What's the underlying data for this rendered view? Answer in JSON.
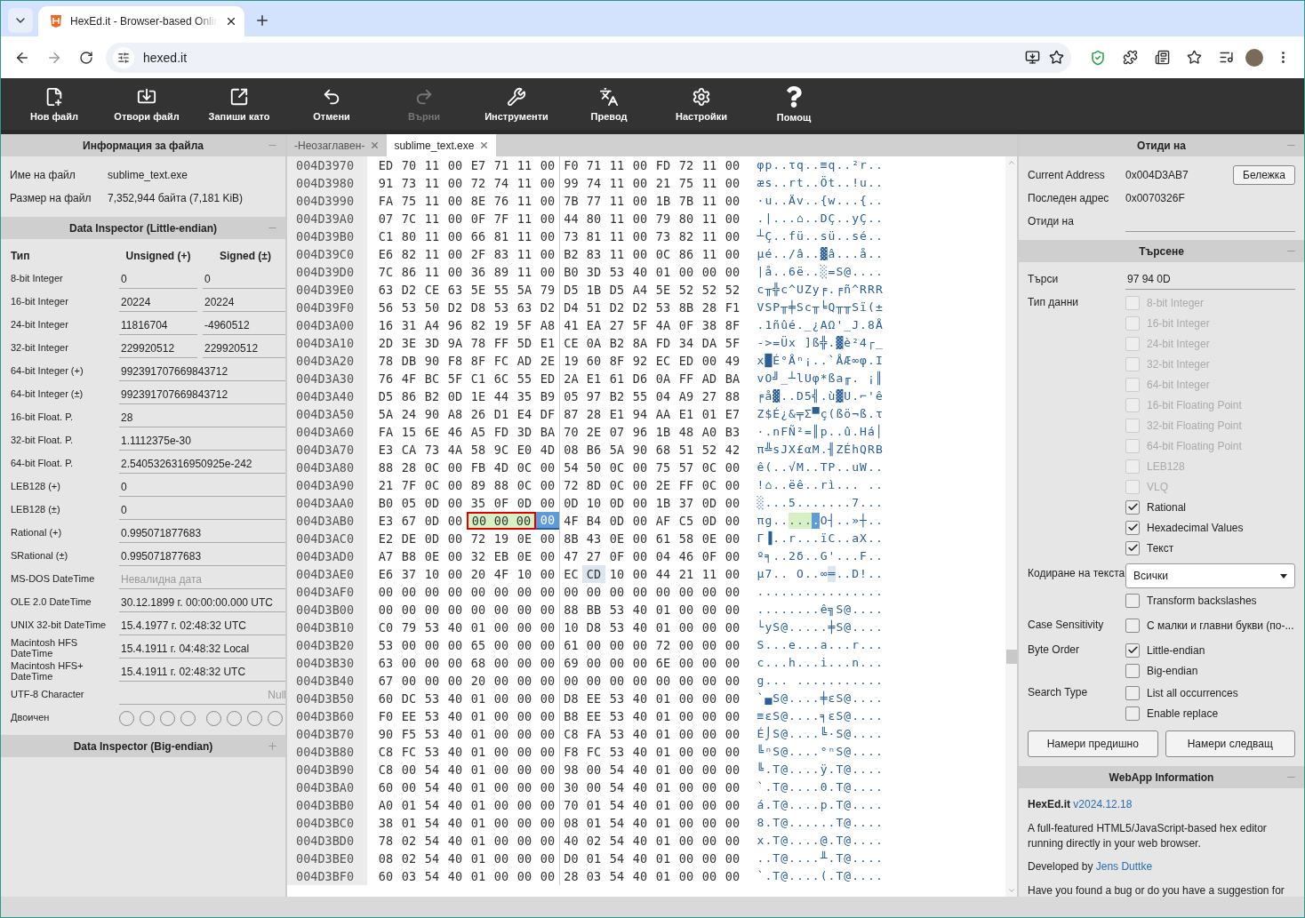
{
  "browser": {
    "tab_title": "HexEd.it - Browser-based Onlin",
    "url": "hexed.it"
  },
  "toolbar": [
    {
      "label": "Нов файл",
      "disabled": false
    },
    {
      "label": "Отвори файл",
      "disabled": false
    },
    {
      "label": "Запиши като",
      "disabled": false
    },
    {
      "label": "Отмени",
      "disabled": false
    },
    {
      "label": "Върни",
      "disabled": true
    },
    {
      "label": "Инструменти",
      "disabled": false
    },
    {
      "label": "Превод",
      "disabled": false
    },
    {
      "label": "Настройки",
      "disabled": false
    },
    {
      "label": "Помощ",
      "disabled": false
    }
  ],
  "file_info": {
    "title": "Информация за файла",
    "expanded": true,
    "fields": [
      {
        "label": "Име на файл",
        "value": "sublime_text.exe"
      },
      {
        "label": "Размер на файл",
        "value": "7,352,944 байта (7,181 KiB)"
      }
    ]
  },
  "inspector": {
    "title": "Data Inspector (Little-endian)",
    "expanded": true,
    "columns": [
      "Тип",
      "Unsigned (+)",
      "Signed (±)"
    ],
    "rows": [
      {
        "kind": "pair",
        "label": "8-bit Integer",
        "unsigned": "0",
        "signed": "0"
      },
      {
        "kind": "pair",
        "label": "16-bit Integer",
        "unsigned": "20224",
        "signed": "20224"
      },
      {
        "kind": "pair",
        "label": "24-bit Integer",
        "unsigned": "11816704",
        "signed": "-4960512"
      },
      {
        "kind": "pair",
        "label": "32-bit Integer",
        "unsigned": "229920512",
        "signed": "229920512"
      },
      {
        "kind": "single",
        "label": "64-bit Integer (+)",
        "value": "992391707669843712"
      },
      {
        "kind": "single",
        "label": "64-bit Integer (±)",
        "value": "992391707669843712"
      },
      {
        "kind": "single",
        "label": "16-bit Float. P.",
        "value": "28"
      },
      {
        "kind": "single",
        "label": "32-bit Float. P.",
        "value": "1.1112375e-30"
      },
      {
        "kind": "single",
        "label": "64-bit Float. P.",
        "value": "2.5405326316950925e-242"
      },
      {
        "kind": "single",
        "label": "LEB128 (+)",
        "value": "0"
      },
      {
        "kind": "single",
        "label": "LEB128 (±)",
        "value": "0"
      },
      {
        "kind": "single",
        "label": "Rational (+)",
        "value": "0.995071877683"
      },
      {
        "kind": "single",
        "label": "SRational (±)",
        "value": "0.995071877683"
      },
      {
        "kind": "single",
        "label": "MS-DOS DateTime",
        "placeholder": "Невалидна дата"
      },
      {
        "kind": "single",
        "label": "OLE 2.0 DateTime",
        "value": "30.12.1899 г. 00:00:00.000 UTC"
      },
      {
        "kind": "single",
        "label": "UNIX 32-bit DateTime",
        "value": "15.4.1977 г. 02:48:32 UTC"
      },
      {
        "kind": "single",
        "label": "Macintosh HFS DateTime",
        "value": "15.4.1911 г. 04:48:32 Local"
      },
      {
        "kind": "single",
        "label": "Macintosh HFS+ DateTime",
        "value": "15.4.1911 г. 02:48:32 UTC"
      },
      {
        "kind": "char",
        "label": "UTF-8 Character",
        "placeholder": "Null"
      },
      {
        "kind": "bits",
        "label": "Двоичен",
        "bits": [
          {
            "checked": false
          },
          {
            "checked": false
          },
          {
            "checked": false
          },
          {
            "checked": false
          },
          {
            "checked": false
          },
          {
            "checked": false
          },
          {
            "checked": false
          },
          {
            "checked": false
          }
        ]
      }
    ]
  },
  "inspector_big": {
    "title": "Data Inspector (Big-endian)",
    "expanded": false
  },
  "file_tabs": [
    {
      "label": "-Неозаглавен-",
      "selected": false
    },
    {
      "label": "sublime_text.exe",
      "selected": true
    }
  ],
  "hex_rows": [
    {
      "address": "004D3970",
      "bytes": "ED 70 11 00 E7 71 11 00 F0 71 11 00 FD 72 11 00",
      "ascii": "φp..τq..≡q..²r.."
    },
    {
      "address": "004D3980",
      "bytes": "91 73 11 00 72 74 11 00 99 74 11 00 21 75 11 00",
      "ascii": "æs..rt..Öt..!u.."
    },
    {
      "address": "004D3990",
      "bytes": "FA 75 11 00 8E 76 11 00 7B 77 11 00 1B 7B 11 00",
      "ascii": "·u..Äv..{w...{.."
    },
    {
      "address": "004D39A0",
      "bytes": "07 7C 11 00 0F 7F 11 00 44 80 11 00 79 80 11 00",
      "ascii": ".|...⌂..DÇ..yÇ.."
    },
    {
      "address": "004D39B0",
      "bytes": "C1 80 11 00 66 81 11 00 73 81 11 00 73 82 11 00",
      "ascii": "┴Ç..fü..sü..sé.."
    },
    {
      "address": "004D39C0",
      "bytes": "E6 82 11 00 2F 83 11 00 B2 83 11 00 0C 86 11 00",
      "ascii": "µé../â..▓â...å.."
    },
    {
      "address": "004D39D0",
      "bytes": "7C 86 11 00 36 89 11 00 B0 3D 53 40 01 00 00 00",
      "ascii": "|å..6ë..░=S@...."
    },
    {
      "address": "004D39E0",
      "bytes": "63 D2 CE 63 5E 55 5A 79 D5 1B D5 A4 5E 52 52 52",
      "ascii": "c╥╬c^UZy╒.╒ñ^RRR"
    },
    {
      "address": "004D39F0",
      "bytes": "56 53 50 D2 D8 53 63 D2 D4 51 D2 D2 53 8B 28 F1",
      "ascii": "VSP╥╪Sc╥╘Q╥╥Sï(±"
    },
    {
      "address": "004D3A00",
      "bytes": "16 31 A4 96 82 19 5F A8 41 EA 27 5F 4A 0F 38 8F",
      "ascii": ".1ñûé._¿AΩ'_J.8Å"
    },
    {
      "address": "004D3A10",
      "bytes": "2D 3E 3D 9A 78 FF 5D E1 CE 0A B2 8A FD 34 DA 5F",
      "ascii": "->=Üx ]ß╬.▓è²4┌_"
    },
    {
      "address": "004D3A20",
      "bytes": "78 DB 90 F8 8F FC AD 2E 19 60 8F 92 EC ED 00 49",
      "ascii": "x█É°Åⁿ¡..`ÅÆ∞φ.I"
    },
    {
      "address": "004D3A30",
      "bytes": "76 4F BC 5F C1 6C 55 ED 2A E1 61 D6 0A FF AD BA",
      "ascii": "vO╝_┴lUφ*ßa╓. ¡║"
    },
    {
      "address": "004D3A40",
      "bytes": "D5 86 B2 0D 1E 44 35 B9 05 97 B2 55 04 A9 27 88",
      "ascii": "╒å▓..D5╣.ù▓U.⌐'ê"
    },
    {
      "address": "004D3A50",
      "bytes": "5A 24 90 A8 26 D1 E4 DF 87 28 E1 94 AA E1 01 E7",
      "ascii": "Z$É¿&╤Σ▀ç(ßö¬ß.τ"
    },
    {
      "address": "004D3A60",
      "bytes": "FA 15 6E 46 A5 FD 3D BA 70 2E 07 96 1B 48 A0 B3",
      "ascii": "·.nFÑ²=║p..û.Há│"
    },
    {
      "address": "004D3A70",
      "bytes": "E3 CA 73 4A 58 9C E0 4D 08 B6 5A 90 68 51 52 42",
      "ascii": "π╩sJX£αM.╢ZÉhQRB"
    },
    {
      "address": "004D3A80",
      "bytes": "88 28 0C 00 FB 4D 0C 00 54 50 0C 00 75 57 0C 00",
      "ascii": "ê(..√M..TP..uW.."
    },
    {
      "address": "004D3A90",
      "bytes": "21 7F 0C 00 89 88 0C 00 72 8D 0C 00 2E FF 0C 00",
      "ascii": "!⌂..ëê..rì... .."
    },
    {
      "address": "004D3AA0",
      "bytes": "B0 05 0D 00 35 0F 0D 00 0D 10 0D 00 1B 37 0D 00",
      "ascii": "░...5.......7..."
    },
    {
      "address": "004D3AB0",
      "bytes": [
        {
          "value": "E3",
          "matched": false,
          "selected": false
        },
        {
          "value": "67",
          "matched": false,
          "selected": false
        },
        {
          "value": "0D",
          "matched": false,
          "selected": false
        },
        {
          "value": "00",
          "matched": false,
          "selected": false
        },
        {
          "value": "00",
          "matched": true,
          "selected": false
        },
        {
          "value": "00",
          "matched": true,
          "selected": false
        },
        {
          "value": "00",
          "matched": true,
          "selected": false
        },
        {
          "value": "00",
          "matched": false,
          "selected": true
        },
        {
          "value": "4F",
          "matched": false,
          "selected": false
        },
        {
          "value": "B4",
          "matched": false,
          "selected": false
        },
        {
          "value": "0D",
          "matched": false,
          "selected": false
        },
        {
          "value": "00",
          "matched": false,
          "selected": false
        },
        {
          "value": "AF",
          "matched": false,
          "selected": false
        },
        {
          "value": "C5",
          "matched": false,
          "selected": false
        },
        {
          "value": "0D",
          "matched": false,
          "selected": false
        },
        {
          "value": "00",
          "matched": false,
          "selected": false
        }
      ],
      "ascii": "πg......O┤..»┼.."
    },
    {
      "address": "004D3AC0",
      "bytes": "E2 DE 0D 00 72 19 0E 00 8B 43 0E 00 61 58 0E 00",
      "ascii": "Γ▐..r...ïC..aX.."
    },
    {
      "address": "004D3AD0",
      "bytes": "A7 B8 0E 00 32 EB 0E 00 47 27 0F 00 04 46 0F 00",
      "ascii": "º╕..2δ..G'...F.."
    },
    {
      "address": "004D3AE0",
      "bytes": [
        {
          "value": "E6",
          "hovered": false
        },
        {
          "value": "37",
          "hovered": false
        },
        {
          "value": "10",
          "hovered": false
        },
        {
          "value": "00",
          "hovered": false
        },
        {
          "value": "20",
          "hovered": false
        },
        {
          "value": "4F",
          "hovered": false
        },
        {
          "value": "10",
          "hovered": false
        },
        {
          "value": "00",
          "hovered": false
        },
        {
          "value": "EC",
          "hovered": false
        },
        {
          "value": "CD",
          "hovered": true
        },
        {
          "value": "10",
          "hovered": false
        },
        {
          "value": "00",
          "hovered": false
        },
        {
          "value": "44",
          "hovered": false
        },
        {
          "value": "21",
          "hovered": false
        },
        {
          "value": "11",
          "hovered": false
        },
        {
          "value": "00",
          "hovered": false
        }
      ],
      "ascii": "µ7.. O..∞═..D!.."
    },
    {
      "address": "004D3AF0",
      "bytes": "00 00 00 00 00 00 00 00 00 00 00 00 00 00 00 00",
      "ascii": "................"
    },
    {
      "address": "004D3B00",
      "bytes": "00 00 00 00 00 00 00 00 88 BB 53 40 01 00 00 00",
      "ascii": "........ê╗S@...."
    },
    {
      "address": "004D3B10",
      "bytes": "C0 79 53 40 01 00 00 00 10 D8 53 40 01 00 00 00",
      "ascii": "└yS@.....╪S@...."
    },
    {
      "address": "004D3B20",
      "bytes": "53 00 00 00 65 00 00 00 61 00 00 00 72 00 00 00",
      "ascii": "S...e...a...r..."
    },
    {
      "address": "004D3B30",
      "bytes": "63 00 00 00 68 00 00 00 69 00 00 00 6E 00 00 00",
      "ascii": "c...h...i...n..."
    },
    {
      "address": "004D3B40",
      "bytes": "67 00 00 00 20 00 00 00 00 00 00 00 00 00 00 00",
      "ascii": "g... ..........."
    },
    {
      "address": "004D3B50",
      "bytes": "60 DC 53 40 01 00 00 00 D8 EE 53 40 01 00 00 00",
      "ascii": "`▄S@....╪εS@...."
    },
    {
      "address": "004D3B60",
      "bytes": "F0 EE 53 40 01 00 00 00 B8 EE 53 40 01 00 00 00",
      "ascii": "≡εS@....╕εS@...."
    },
    {
      "address": "004D3B70",
      "bytes": "90 F5 53 40 01 00 00 00 C8 FA 53 40 01 00 00 00",
      "ascii": "É⌡S@....╚·S@...."
    },
    {
      "address": "004D3B80",
      "bytes": "C8 FC 53 40 01 00 00 00 F8 FC 53 40 01 00 00 00",
      "ascii": "╚ⁿS@....°ⁿS@...."
    },
    {
      "address": "004D3B90",
      "bytes": "C8 00 54 40 01 00 00 00 98 00 54 40 01 00 00 00",
      "ascii": "╚.T@....ÿ.T@...."
    },
    {
      "address": "004D3BA0",
      "bytes": "60 00 54 40 01 00 00 00 30 00 54 40 01 00 00 00",
      "ascii": "`.T@....0.T@...."
    },
    {
      "address": "004D3BB0",
      "bytes": "A0 01 54 40 01 00 00 00 70 01 54 40 01 00 00 00",
      "ascii": "á.T@....p.T@...."
    },
    {
      "address": "004D3BC0",
      "bytes": "38 01 54 40 01 00 00 00 08 01 54 40 01 00 00 00",
      "ascii": "8.T@......T@...."
    },
    {
      "address": "004D3BD0",
      "bytes": "78 02 54 40 01 00 00 00 40 02 54 40 01 00 00 00",
      "ascii": "x.T@....@.T@...."
    },
    {
      "address": "004D3BE0",
      "bytes": "08 02 54 40 01 00 00 00 D0 01 54 40 01 00 00 00",
      "ascii": "..T@....╨.T@...."
    },
    {
      "address": "004D3BF0",
      "bytes": "60 03 54 40 01 00 00 00 28 03 54 40 01 00 00 00",
      "ascii": "`.T@....(.T@...."
    }
  ],
  "goto": {
    "title": "Отиди на",
    "expanded": true,
    "current_label": "Current Address",
    "current_value": "0x004D3AB7",
    "note_button": "Бележка",
    "last_label": "Последен адрес",
    "last_value": "0x0070326F",
    "goto_label": "Отиди на"
  },
  "search": {
    "title": "Търсене",
    "expanded": true,
    "query_label": "Търси",
    "query": "97 94 0D",
    "groups": [
      {
        "kind": "checks",
        "label": "Тип данни",
        "items": [
          {
            "label": "8-bit Integer",
            "checked": false,
            "disabled": true
          },
          {
            "label": "16-bit Integer",
            "checked": false,
            "disabled": true
          },
          {
            "label": "24-bit Integer",
            "checked": false,
            "disabled": true
          },
          {
            "label": "32-bit Integer",
            "checked": false,
            "disabled": true
          },
          {
            "label": "64-bit Integer",
            "checked": false,
            "disabled": true
          },
          {
            "label": "16-bit Floating Point",
            "checked": false,
            "disabled": true
          },
          {
            "label": "32-bit Floating Point",
            "checked": false,
            "disabled": true
          },
          {
            "label": "64-bit Floating Point",
            "checked": false,
            "disabled": true
          },
          {
            "label": "LEB128",
            "checked": false,
            "disabled": true
          },
          {
            "label": "VLQ",
            "checked": false,
            "disabled": true
          },
          {
            "label": "Rational",
            "checked": true,
            "disabled": false
          },
          {
            "label": "Hexadecimal Values",
            "checked": true,
            "disabled": false
          },
          {
            "label": "Текст",
            "checked": true,
            "disabled": false
          }
        ]
      },
      {
        "kind": "select",
        "label": "Кодиране на текста",
        "value": "Всички"
      },
      {
        "kind": "checks",
        "items": [
          {
            "label": "Transform backslashes",
            "checked": false,
            "disabled": false
          }
        ]
      },
      {
        "kind": "checks",
        "label": "Case Sensitivity",
        "items": [
          {
            "label": "С малки и главни букви (по-...",
            "checked": false,
            "disabled": false
          }
        ]
      },
      {
        "kind": "checks",
        "label": "Byte Order",
        "items": [
          {
            "label": "Little-endian",
            "checked": true,
            "disabled": false
          },
          {
            "label": "Big-endian",
            "checked": false,
            "disabled": false
          }
        ]
      },
      {
        "kind": "checks",
        "label": "Search Type",
        "items": [
          {
            "label": "List all occurrences",
            "checked": false,
            "disabled": false
          },
          {
            "label": "Enable replace",
            "checked": false,
            "disabled": false
          }
        ]
      }
    ],
    "buttons": [
      "Намери предишно",
      "Намери следващ"
    ]
  },
  "webapp": {
    "title": "WebApp Information",
    "expanded": true,
    "name": "HexEd.it",
    "version": "v2024.12.18",
    "description": "A full-featured HTML5/JavaScript-based hex editor running directly in your web browser.",
    "developed_by": "Developed by",
    "author": "Jens Duttke",
    "more": "Have you found a bug or do you have a suggestion for"
  }
}
